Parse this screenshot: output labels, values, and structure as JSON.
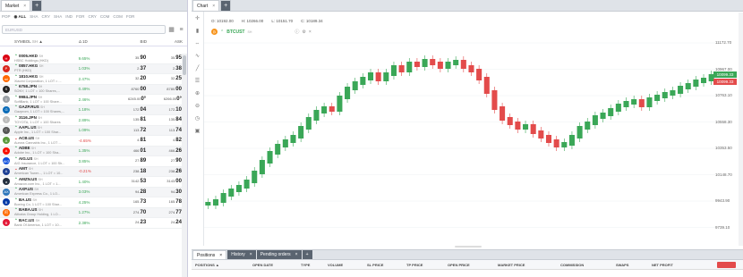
{
  "market": {
    "tab_label": "Market",
    "categories": [
      "POP",
      "ALL",
      "SHA",
      "CRY",
      "SHA",
      "IND",
      "FOR",
      "CRY",
      "COM",
      "COM",
      "FOR"
    ],
    "active_category": 1,
    "search_placeholder": "EURUSD",
    "headers": {
      "symbol": "SYMBOL",
      "symbol_sub": "SH",
      "change": "Δ 1D",
      "bid": "BID",
      "ask": "ASK"
    },
    "rows": [
      {
        "sym": "0005.HKD",
        "name": "HSBC Holdings (HKD)",
        "chg": "9.65%",
        "dir": "up",
        "bid_s": "35.",
        "bid_b": "90",
        "ask_s": "35.",
        "ask_b": "95",
        "color": "#db0011",
        "glyph": "H"
      },
      {
        "sym": "0857.HKG",
        "name": "PTR (HKD)",
        "chg": "1.03%",
        "dir": "up",
        "bid_s": "2.",
        "bid_b": "37",
        "ask_s": "2.",
        "ask_b": "38",
        "color": "#d9251c",
        "glyph": "P"
      },
      {
        "sym": "1810.HKG",
        "name": "Xiaomi Corporation, 1 LOT = ...",
        "chg": "2.47%",
        "dir": "up",
        "bid_s": "32.",
        "bid_b": "20",
        "ask_s": "32.",
        "ask_b": "25",
        "color": "#ff6900",
        "glyph": "mi"
      },
      {
        "sym": "6758.JPN",
        "name": "SONY, 1 LOT = 100 Shares,...",
        "chg": "0.49%",
        "dir": "up",
        "bid_s": "8760.",
        "bid_b": "00",
        "ask_s": "8780.",
        "ask_b": "00",
        "color": "#222222",
        "glyph": "S"
      },
      {
        "sym": "9984.JPN",
        "name": "SoftBank, 1 LOT = 100 Share...",
        "chg": "2.46%",
        "dir": "up",
        "bid_s": "6245.00",
        "bid_b": "0°",
        "ask_s": "6266.00",
        "ask_b": "0°",
        "color": "#9aa0a6",
        "glyph": "≡"
      },
      {
        "sym": "GAZP.RUS",
        "name": "Gazprom, 1 LOT = 100 Shares,...",
        "chg": "1.18%",
        "dir": "up",
        "bid_s": "172.",
        "bid_b": "04",
        "ask_s": "172.",
        "ask_b": "10",
        "color": "#0a6bb8",
        "glyph": "G"
      },
      {
        "sym": "3116.JPN",
        "name": "TOYOTA, 1 LOT = 100 Shares",
        "chg": "2.89%",
        "dir": "up",
        "bid_s": "135.",
        "bid_b": "81",
        "ask_s": "135.",
        "ask_b": "84",
        "color": "#bbbbbb",
        "glyph": "T"
      },
      {
        "sym": "AAPL.US",
        "name": "Apple Inc., 1 LOT = 100 Shar...",
        "chg": "1.09%",
        "dir": "up",
        "bid_s": "113.",
        "bid_b": "72",
        "ask_s": "113.",
        "ask_b": "74",
        "color": "#555555",
        "glyph": ""
      },
      {
        "sym": "ACB.US",
        "name": "Aurora Cannabis Inc., 1 LOT ...",
        "chg": "-4.65%",
        "dir": "dn",
        "bid_s": "4.",
        "bid_b": "81",
        "ask_s": "4.",
        "ask_b": "82",
        "color": "#5a9a3c",
        "glyph": "A"
      },
      {
        "sym": "ADBE",
        "name": "Adobe Inc., 1 LOT = 100 Sha...",
        "chg": "1.35%",
        "dir": "up",
        "bid_s": "466.",
        "bid_b": "01",
        "ask_s": "466.",
        "ask_b": "26",
        "color": "#fa0f00",
        "glyph": "A"
      },
      {
        "sym": "AIG.US",
        "name": "AIG Insurance, 1 LOT = 100 Sh...",
        "chg": "3.85%",
        "dir": "up",
        "bid_s": "27.",
        "bid_b": "89",
        "ask_s": "27.",
        "ask_b": "90",
        "color": "#1352de",
        "glyph": "AIG"
      },
      {
        "sym": "AMT",
        "name": "American Tower..., 1 LOT = 10...",
        "chg": "-0.21%",
        "dir": "dn",
        "bid_s": "238.",
        "bid_b": "18",
        "ask_s": "238.",
        "ask_b": "26",
        "color": "#1c3f94",
        "glyph": "A"
      },
      {
        "sym": "AMZN.US",
        "name": "Amazon.com Inc., 1 LOT = 1...",
        "chg": "1.40%",
        "dir": "up",
        "bid_s": "3142.",
        "bid_b": "53",
        "ask_s": "3143.",
        "ask_b": "00",
        "color": "#232f3e",
        "glyph": "a"
      },
      {
        "sym": "AXP.US",
        "name": "American Express Co., 1 LO...",
        "chg": "3.03%",
        "dir": "up",
        "bid_s": "94.",
        "bid_b": "28",
        "ask_s": "94.",
        "ask_b": "30",
        "color": "#2e77bb",
        "glyph": "AX"
      },
      {
        "sym": "BA.US",
        "name": "Boeing Co, 1 LOT = 100 Shar...",
        "chg": "4.25%",
        "dir": "up",
        "bid_s": "165.",
        "bid_b": "73",
        "ask_s": "165.",
        "ask_b": "78",
        "color": "#0039a6",
        "glyph": "B"
      },
      {
        "sym": "BABA.US",
        "name": "Alibaba Group Holding, 1 LO...",
        "chg": "1.27%",
        "dir": "up",
        "bid_s": "274.",
        "bid_b": "70",
        "ask_s": "274.",
        "ask_b": "77",
        "color": "#ff6a00",
        "glyph": "阿"
      },
      {
        "sym": "BAC.US",
        "name": "Bank Of America, 1 LOT = 10...",
        "chg": "2.38%",
        "dir": "up",
        "bid_s": "24.",
        "bid_b": "23",
        "ask_s": "24.",
        "ask_b": "24",
        "color": "#e31837",
        "glyph": "B"
      }
    ]
  },
  "chart": {
    "tab_label": "Chart",
    "ohlc": {
      "o": "O: 10192.00",
      "h": "H: 10266.00",
      "l": "L: 10151.70",
      "c": "C: 10189.34"
    },
    "instrument": "BTCUST",
    "instrument_sub": "SH",
    "price_tags": {
      "ask": "10099.33",
      "bid": "10099.33"
    },
    "y_labels": [
      "11172.70",
      "10967.00",
      "10763.10",
      "10558.30",
      "10353.50",
      "10148.70",
      "9943.90",
      "9739.10"
    ]
  },
  "positions": {
    "tabs": [
      "Positions",
      "History",
      "Pending orders"
    ],
    "headers": [
      "POSITIONS",
      "OPEN DATE",
      "TYPE",
      "VOLUME",
      "SL PRICE",
      "TP PRICE",
      "OPEN PRICE",
      "MARKET PRICE",
      "COMMISSION",
      "SWAPS",
      "NET PROFIT"
    ]
  },
  "colors": {
    "up": "#3aa757",
    "down": "#e34b4b",
    "accent": "#5a6470"
  }
}
